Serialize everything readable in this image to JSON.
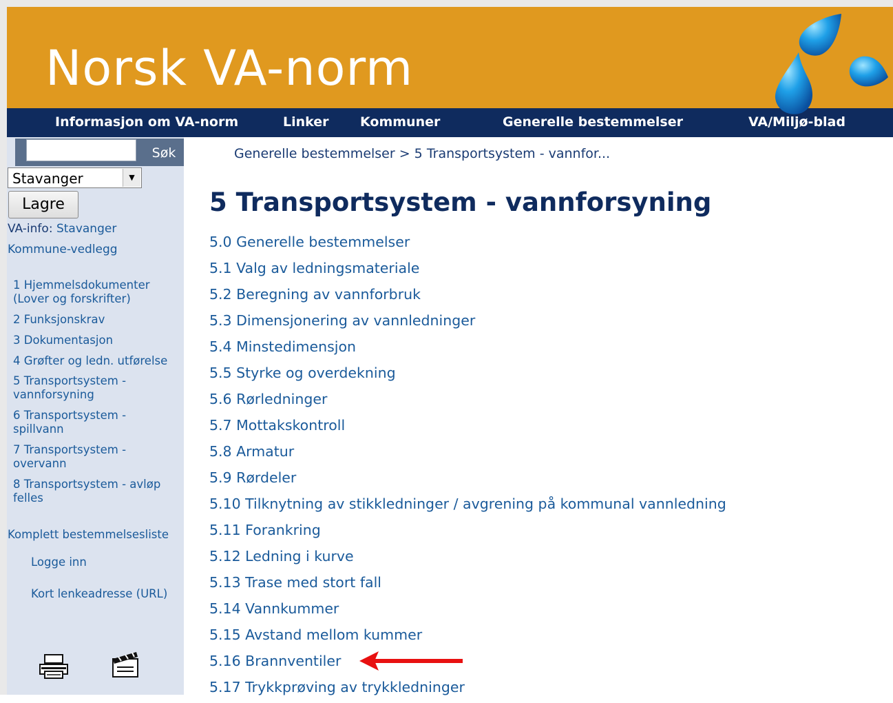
{
  "header": {
    "title": "Norsk VA-norm"
  },
  "nav": {
    "items": [
      "Informasjon om VA-norm",
      "Linker",
      "Kommuner",
      "Generelle bestemmelser",
      "VA/Miljø-blad"
    ]
  },
  "sidebar": {
    "search": {
      "placeholder": "",
      "button_label": "Søk"
    },
    "municipality": {
      "selected": "Stavanger"
    },
    "save_label": "Lagre",
    "va_info_label": "VA-info:",
    "va_info_link": "Stavanger",
    "appendix_link": "Kommune-vedlegg",
    "chapters": [
      "1 Hjemmelsdokumenter (Lover og forskrifter)",
      "2 Funksjonskrav",
      "3 Dokumentasjon",
      "4 Grøfter og ledn. utførelse",
      "5 Transportsystem - vannforsyning",
      "6 Transportsystem - spillvann",
      "7 Transportsystem - overvann",
      "8 Transportsystem - avløp felles"
    ],
    "full_list_link": "Komplett bestemmelsesliste",
    "login_link": "Logge inn",
    "short_url_link": "Kort lenkeadresse (URL)",
    "icons": [
      "printer-icon",
      "clapperboard-icon"
    ]
  },
  "main": {
    "breadcrumb": "Generelle bestemmelser > 5 Transportsystem - vannfor...",
    "title": "5 Transportsystem - vannforsyning",
    "sections": [
      "5.0 Generelle bestemmelser",
      "5.1 Valg av ledningsmateriale",
      "5.2 Beregning av vannforbruk",
      "5.3 Dimensjonering av vannledninger",
      "5.4 Minstedimensjon",
      "5.5 Styrke og overdekning",
      "5.6 Rørledninger",
      "5.7 Mottakskontroll",
      "5.8 Armatur",
      "5.9 Rørdeler",
      "5.10 Tilknytning av stikkledninger / avgrening på kommunal vannledning",
      "5.11 Forankring",
      "5.12 Ledning i kurve",
      "5.13 Trase med stort fall",
      "5.14 Vannkummer",
      "5.15 Avstand mellom kummer",
      "5.16 Brannventiler",
      "5.17 Trykkprøving av trykkledninger"
    ],
    "highlighted_section": "5.16 Brannventiler"
  },
  "colors": {
    "header_orange": "#e0991f",
    "nav_navy": "#0f2b5e",
    "sidebar_bg": "#dce3ef",
    "link_blue": "#1a5a9a",
    "annotation_red": "#e81010"
  }
}
